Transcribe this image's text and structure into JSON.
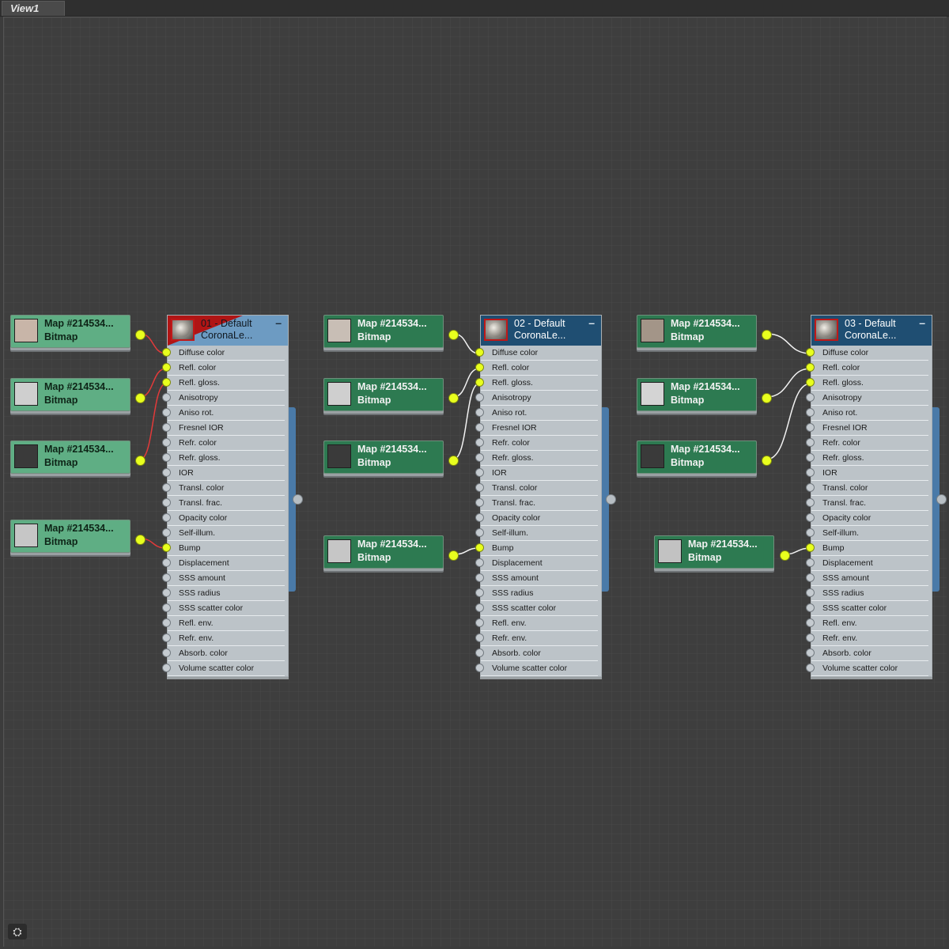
{
  "window": {
    "tab_label": "View1"
  },
  "map_nodes": [
    {
      "title": "Map #214534...",
      "type": "Bitmap",
      "thumb_color": "#c8b5a8"
    },
    {
      "title": "Map #214534...",
      "type": "Bitmap",
      "thumb_color": "#cfcfcf"
    },
    {
      "title": "Map #214534...",
      "type": "Bitmap",
      "thumb_color": "#3a3a3a"
    },
    {
      "title": "Map #214534...",
      "type": "Bitmap",
      "thumb_color": "#c6c6c6"
    },
    {
      "title": "Map #214534...",
      "type": "Bitmap",
      "thumb_color": "#c8beb5"
    },
    {
      "title": "Map #214534...",
      "type": "Bitmap",
      "thumb_color": "#cfcfcf"
    },
    {
      "title": "Map #214534...",
      "type": "Bitmap",
      "thumb_color": "#3a3a3a"
    },
    {
      "title": "Map #214534...",
      "type": "Bitmap",
      "thumb_color": "#c6c6c6"
    },
    {
      "title": "Map #214534...",
      "type": "Bitmap",
      "thumb_color": "#a39588"
    },
    {
      "title": "Map #214534...",
      "type": "Bitmap",
      "thumb_color": "#d4d4d4"
    },
    {
      "title": "Map #214534...",
      "type": "Bitmap",
      "thumb_color": "#3a3a3a"
    },
    {
      "title": "Map #214534...",
      "type": "Bitmap",
      "thumb_color": "#c2c2c2"
    }
  ],
  "materials": [
    {
      "title_line1": "01 - Default",
      "title_line2": "CoronaLe...",
      "selected": true,
      "collapse_label": "–"
    },
    {
      "title_line1": "02 - Default",
      "title_line2": "CoronaLe...",
      "selected": false,
      "collapse_label": "–"
    },
    {
      "title_line1": "03 - Default",
      "title_line2": "CoronaLe...",
      "selected": false,
      "collapse_label": "–"
    }
  ],
  "slots": [
    "Diffuse color",
    "Refl. color",
    "Refl. gloss.",
    "Anisotropy",
    "Aniso rot.",
    "Fresnel IOR",
    "Refr. color",
    "Refr. gloss.",
    "IOR",
    "Transl. color",
    "Transl. frac.",
    "Opacity color",
    "Self-illum.",
    "Bump",
    "Displacement",
    "SSS amount",
    "SSS radius",
    "SSS scatter color",
    "Refl. env.",
    "Refr. env.",
    "Absorb. color",
    "Volume scatter color"
  ],
  "connected_slot_indices": [
    0,
    1,
    2,
    13
  ],
  "colors": {
    "wire_selected": "#e23a3a",
    "wire_normal": "#f2f2f2",
    "port_active": "#e8ff1e"
  },
  "corner_icon": "binoculars-icon"
}
